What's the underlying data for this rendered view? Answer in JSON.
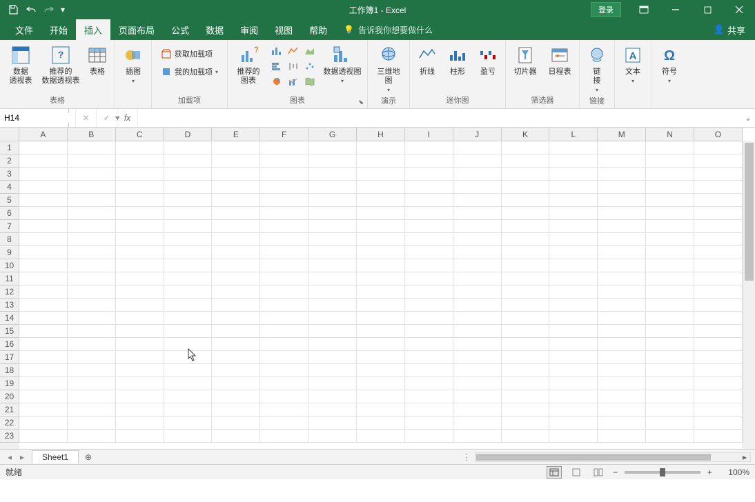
{
  "title": "工作簿1 - Excel",
  "login": "登录",
  "tabs": {
    "file": "文件",
    "home": "开始",
    "insert": "插入",
    "pagelayout": "页面布局",
    "formulas": "公式",
    "data": "数据",
    "review": "审阅",
    "view": "视图",
    "help": "帮助"
  },
  "tell_me": "告诉我你想要做什么",
  "share": "共享",
  "ribbon": {
    "tables_group": "表格",
    "pivot_table": "数据\n透视表",
    "rec_pivot": "推荐的\n数据透视表",
    "table": "表格",
    "illustrations": "插图",
    "addins_group": "加载项",
    "get_addins": "获取加载项",
    "my_addins": "我的加载项",
    "rec_charts": "推荐的\n图表",
    "charts_group": "图表",
    "pivot_chart": "数据透视图",
    "map3d": "三维地\n图",
    "tours_group": "演示",
    "sparkline_line": "折线",
    "sparkline_column": "柱形",
    "sparkline_winloss": "盈亏",
    "sparklines_group": "迷你图",
    "slicer": "切片器",
    "timeline": "日程表",
    "filters_group": "筛选器",
    "link": "链\n接",
    "links_group": "链接",
    "text": "文本",
    "symbol": "符号"
  },
  "name_box": "H14",
  "columns": [
    "A",
    "B",
    "C",
    "D",
    "E",
    "F",
    "G",
    "H",
    "I",
    "J",
    "K",
    "L",
    "M",
    "N",
    "O"
  ],
  "row_count": 23,
  "sheet": "Sheet1",
  "status_ready": "就绪",
  "zoom": "100%"
}
